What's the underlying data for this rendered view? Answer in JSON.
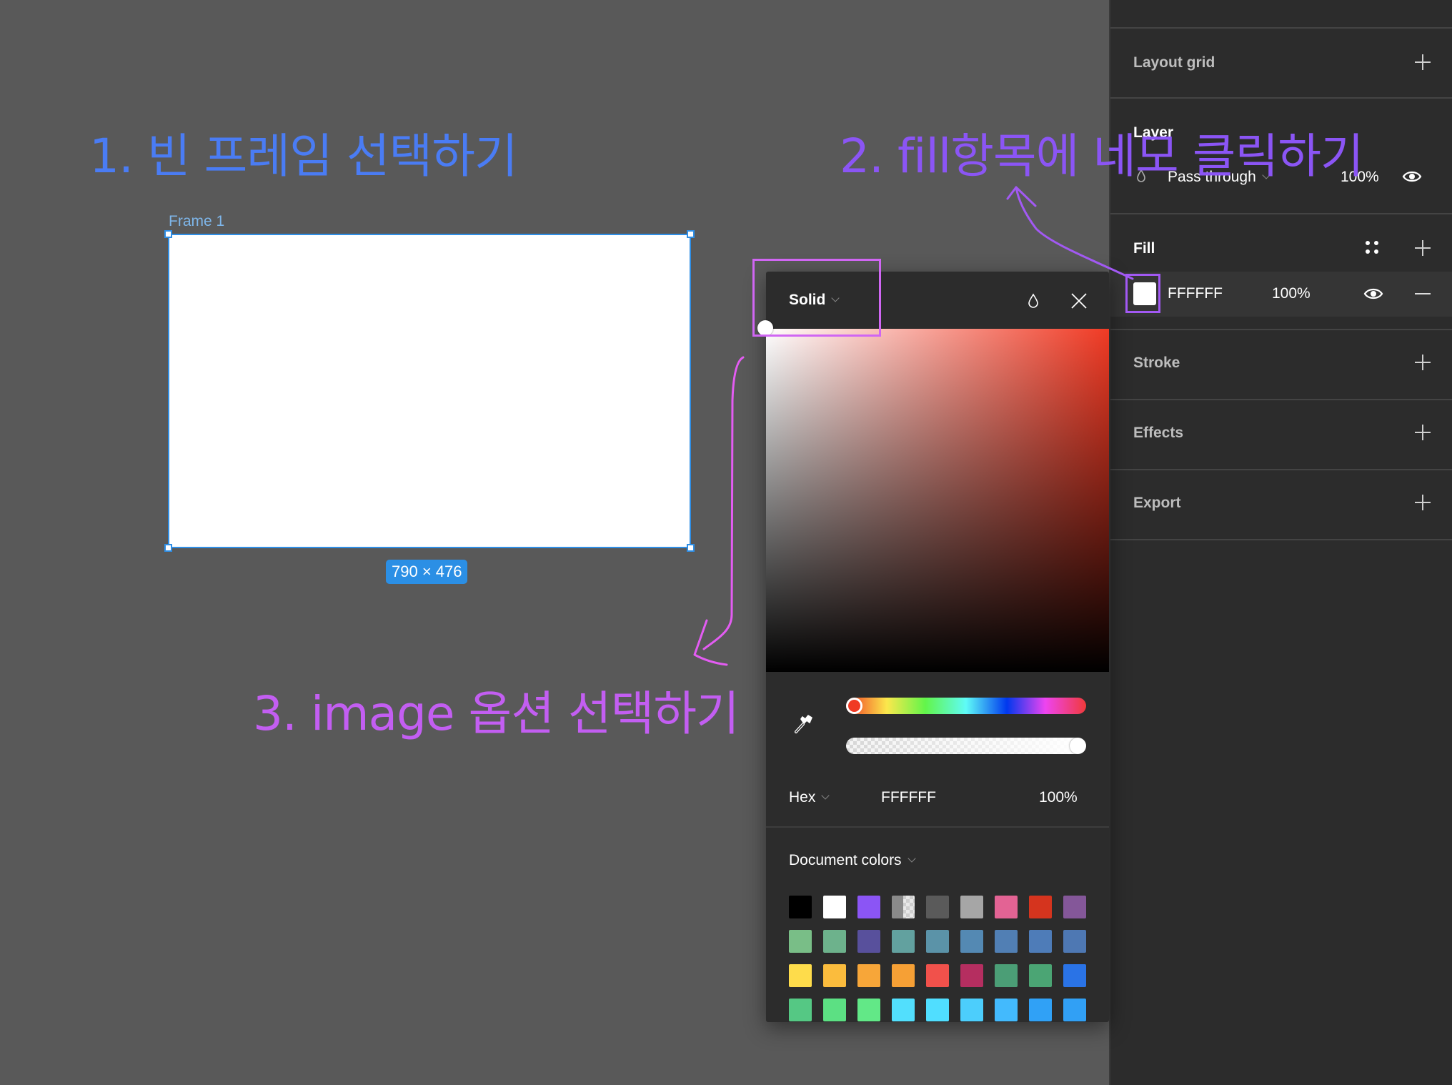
{
  "canvas": {
    "frame_name": "Frame 1",
    "frame_size_label": "790 × 476",
    "selection_color": "#2f8ee5"
  },
  "annotations": {
    "step1": "1. 빈 프레임 선택하기",
    "step2": "2. fill항목에 네모 클릭하기",
    "step3": "3. image 옵션 선택하기",
    "colors": [
      "#4a7cf4",
      "#8b55f5",
      "#c35ef2"
    ]
  },
  "sidebar": {
    "layout_grid": "Layout grid",
    "layer": {
      "title": "Layer",
      "blend_mode": "Pass through",
      "opacity": "100%"
    },
    "fill": {
      "title": "Fill",
      "hex": "FFFFFF",
      "opacity": "100%",
      "color": "#FFFFFF"
    },
    "stroke": "Stroke",
    "effects": "Effects",
    "export": "Export"
  },
  "picker": {
    "type": "Solid",
    "hue_value": 0,
    "alpha_percent": 100,
    "format": "Hex",
    "hex": "FFFFFF",
    "opacity": "100%",
    "document_colors_label": "Document colors",
    "document_colors": [
      "#000000",
      "#FFFFFF",
      "#8B55F5",
      "mixed-transparent",
      "#5A5A5A",
      "#A6A6A6",
      "#E36394",
      "#D5341E",
      "#845799",
      "#79BE87",
      "#6DB28C",
      "#58509C",
      "#62A19F",
      "#5B93A8",
      "#5489B3",
      "#517FB4",
      "#4E7CB8",
      "#4E78B3",
      "#FEDC4B",
      "#FBBC3D",
      "#F7A639",
      "#F6A035",
      "#F1514B",
      "#B52E60",
      "#4B9E76",
      "#4BA574",
      "#2A73E6",
      "#55C884",
      "#5CE083",
      "#62E887",
      "#52DFFD",
      "#50DEFF",
      "#4CCEFC",
      "#43BAFD",
      "#30A1F6",
      "#31A0F5"
    ]
  }
}
